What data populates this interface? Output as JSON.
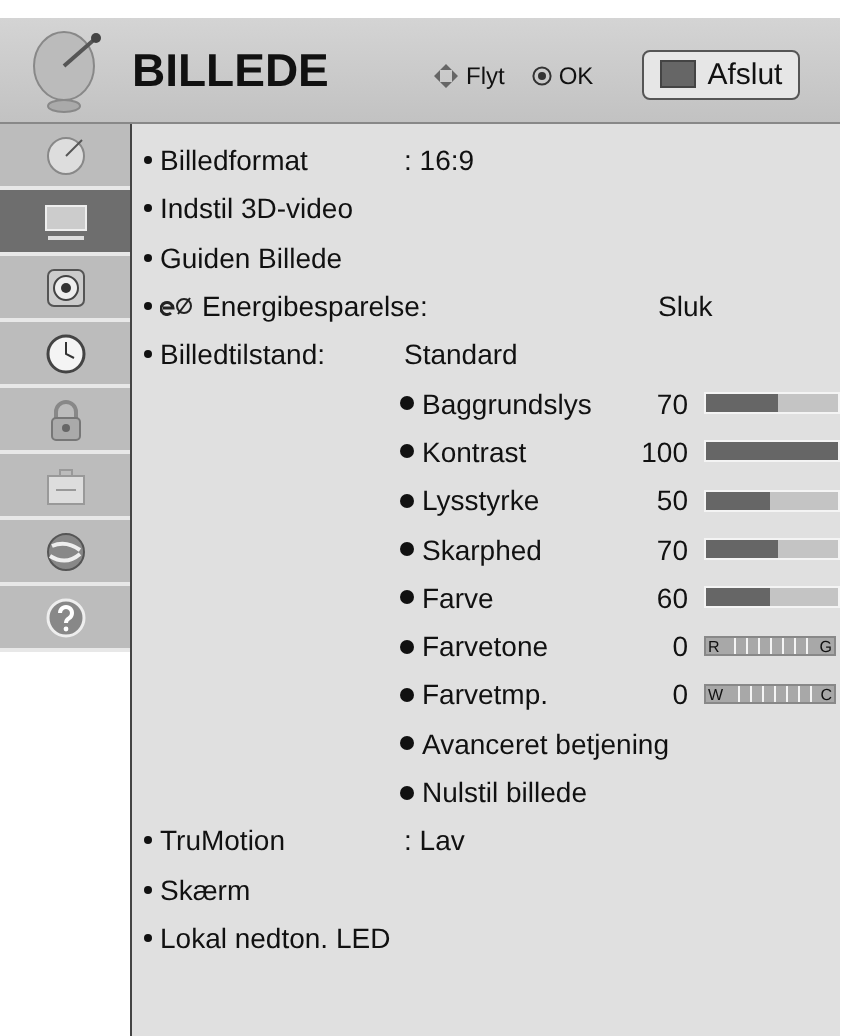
{
  "header": {
    "title": "BILLEDE",
    "hints": [
      {
        "kind": "move",
        "label": "Flyt"
      },
      {
        "kind": "ok",
        "label": "OK"
      }
    ],
    "exit_button": "Afslut"
  },
  "sidebar": {
    "items": [
      {
        "kind": "dish",
        "selected": false
      },
      {
        "kind": "tv",
        "selected": true
      },
      {
        "kind": "speaker",
        "selected": false
      },
      {
        "kind": "clock",
        "selected": false
      },
      {
        "kind": "lock",
        "selected": false
      },
      {
        "kind": "toolbox",
        "selected": false
      },
      {
        "kind": "globe",
        "selected": false
      },
      {
        "kind": "help",
        "selected": false
      }
    ]
  },
  "menu": [
    {
      "kind": "setting",
      "label": "Billedformat",
      "value": ": 16:9"
    },
    {
      "kind": "setting",
      "label": "Indstil 3D-video"
    },
    {
      "kind": "setting",
      "label": "Guiden Billede"
    },
    {
      "kind": "eco",
      "label": "Energibesparelse:",
      "value": "Sluk"
    },
    {
      "kind": "setting",
      "label": "Billedtilstand:",
      "value": "Standard",
      "children": [
        {
          "kind": "slider",
          "label": "Baggrundslys",
          "value": "70",
          "level": 0.55
        },
        {
          "kind": "slider",
          "label": "Kontrast",
          "value": "100",
          "level": 1.0
        },
        {
          "kind": "slider",
          "label": "Lysstyrke",
          "value": "50",
          "level": 0.48
        },
        {
          "kind": "slider",
          "label": "Skarphed",
          "value": "70",
          "level": 0.55
        },
        {
          "kind": "slider",
          "label": "Farve",
          "value": "60",
          "level": 0.48
        },
        {
          "kind": "balance",
          "label": "Farvetone",
          "value": "0",
          "left": "R",
          "right": "G"
        },
        {
          "kind": "balance",
          "label": "Farvetmp.",
          "value": "0",
          "left": "W",
          "right": "C"
        },
        {
          "kind": "action",
          "label": "Avanceret betjening"
        },
        {
          "kind": "action",
          "label": "Nulstil billede"
        }
      ]
    },
    {
      "kind": "setting",
      "label": "TruMotion",
      "value": ": Lav"
    },
    {
      "kind": "setting",
      "label": "Skærm"
    },
    {
      "kind": "setting",
      "label": "Lokal nedton. LED"
    }
  ]
}
